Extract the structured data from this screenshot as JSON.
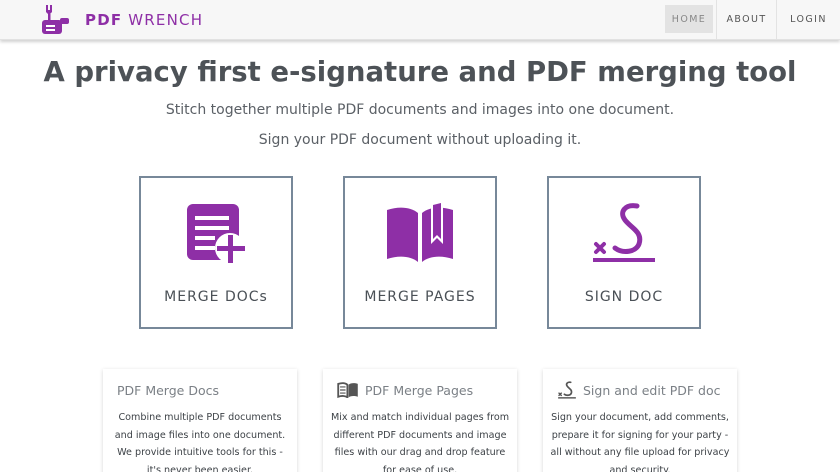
{
  "navbar": {
    "brand_strong": "PDF",
    "brand_rest": "WRENCH",
    "logo_icon": "wrench-hand-logo",
    "links": [
      {
        "label": "HOME",
        "active": true
      },
      {
        "label": "ABOUT",
        "active": false
      },
      {
        "label": "LOGIN",
        "active": false
      }
    ]
  },
  "hero": {
    "title": "A privacy first e-signature and PDF merging tool",
    "subtitle_1": "Stitch together multiple PDF documents and images into one document.",
    "subtitle_2": "Sign your PDF document without uploading it."
  },
  "tiles": [
    {
      "label": "MERGE DOCs",
      "icon": "document-add-icon"
    },
    {
      "label": "MERGE PAGES",
      "icon": "open-book-icon"
    },
    {
      "label": "SIGN DOC",
      "icon": "signature-icon"
    }
  ],
  "cards": [
    {
      "title": "PDF Merge Docs",
      "icon": null,
      "text": "Combine multiple PDF documents and image files into one document. We provide intuitive tools for this - it's never been easier."
    },
    {
      "title": "PDF Merge Pages",
      "icon": "open-book-icon",
      "text": "Mix and match individual pages from different PDF documents and image files with our drag and drop feature for ease of use."
    },
    {
      "title": "Sign and edit PDF doc",
      "icon": "signature-icon",
      "text": "Sign your document, add comments, prepare it for signing for your party - all without any file upload for privacy and security."
    }
  ],
  "colors": {
    "brand": "#8e2fa6",
    "tile_border": "#778899",
    "text": "#4a5056"
  }
}
